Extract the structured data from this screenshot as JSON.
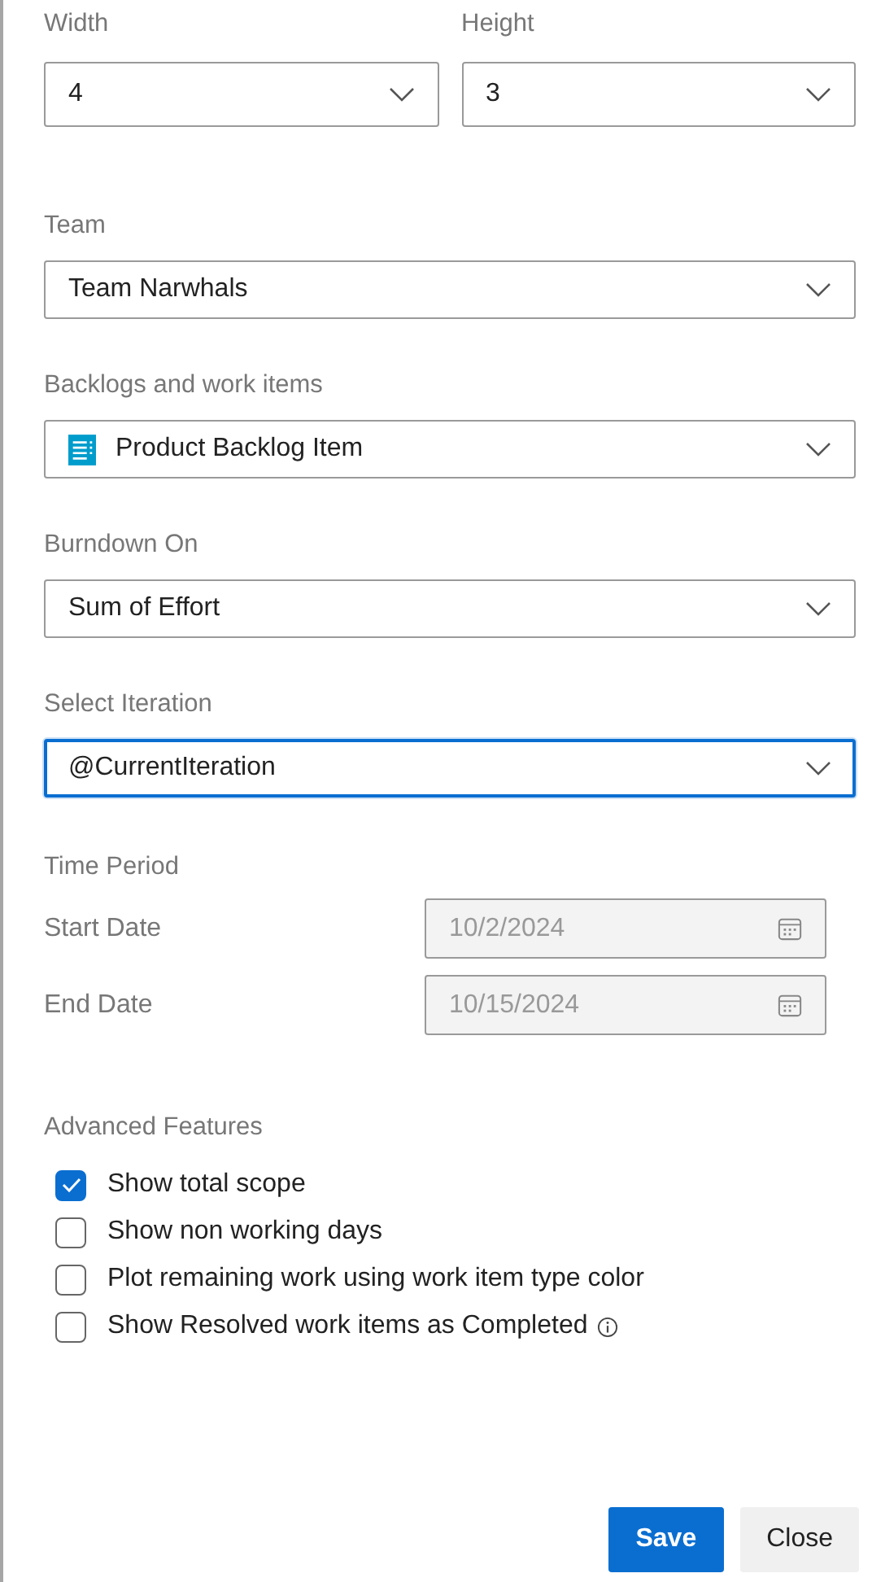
{
  "size": [
    {
      "label": "Width",
      "value": "4"
    },
    {
      "label": "Height",
      "value": "3"
    }
  ],
  "dropdowns": [
    {
      "label": "Team",
      "value": "Team Narwhals",
      "kind": "plain",
      "focused": false
    },
    {
      "label": "Backlogs and work items",
      "value": "Product Backlog Item",
      "kind": "work-item",
      "focused": false
    },
    {
      "label": "Burndown On",
      "value": "Sum of Effort",
      "kind": "plain",
      "focused": false
    },
    {
      "label": "Select Iteration",
      "value": "@CurrentIteration",
      "kind": "plain",
      "focused": true
    }
  ],
  "time_period": {
    "title": "Time Period",
    "dates": [
      {
        "label": "Start Date",
        "value": "10/2/2024",
        "disabled": true
      },
      {
        "label": "End Date",
        "value": "10/15/2024",
        "disabled": true
      }
    ]
  },
  "advanced": {
    "title": "Advanced Features",
    "options": [
      {
        "label": "Show total scope",
        "checked": true,
        "info": false
      },
      {
        "label": "Show non working days",
        "checked": false,
        "info": false
      },
      {
        "label": "Plot remaining work using work item type color",
        "checked": false,
        "info": false
      },
      {
        "label": "Show Resolved work items as Completed",
        "checked": false,
        "info": true
      }
    ]
  },
  "buttons": [
    {
      "label": "Save",
      "kind": "primary"
    },
    {
      "label": "Close",
      "kind": "secondary"
    }
  ]
}
